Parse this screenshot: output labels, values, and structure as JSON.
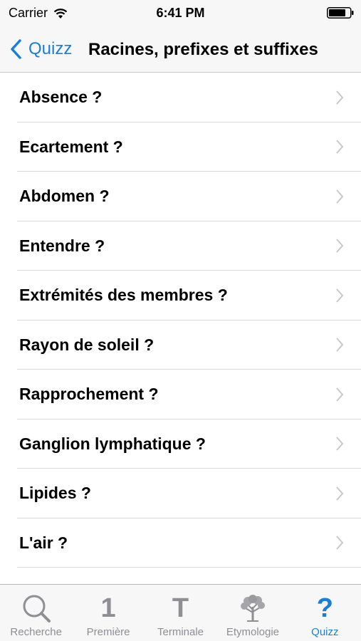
{
  "status": {
    "carrier": "Carrier",
    "time": "6:41 PM"
  },
  "nav": {
    "back_label": "Quizz",
    "title": "Racines, prefixes et suffixes"
  },
  "list": [
    {
      "label": "Absence ?"
    },
    {
      "label": "Ecartement ?"
    },
    {
      "label": "Abdomen ?"
    },
    {
      "label": "Entendre ?"
    },
    {
      "label": "Extrémités des membres ?"
    },
    {
      "label": "Rayon de soleil ?"
    },
    {
      "label": "Rapprochement ?"
    },
    {
      "label": "Ganglion lymphatique ?"
    },
    {
      "label": "Lipides ?"
    },
    {
      "label": "L'air ?"
    }
  ],
  "tabs": [
    {
      "label": "Recherche",
      "icon": "search-icon"
    },
    {
      "label": "Première",
      "icon": "one-icon",
      "glyph": "1"
    },
    {
      "label": "Terminale",
      "icon": "t-icon",
      "glyph": "T"
    },
    {
      "label": "Etymologie",
      "icon": "tree-icon"
    },
    {
      "label": "Quizz",
      "icon": "question-icon",
      "glyph": "?",
      "active": true
    }
  ],
  "colors": {
    "accent": "#1a7fd4",
    "inactive": "#8e8e93",
    "bar_background": "#f7f7f7"
  }
}
